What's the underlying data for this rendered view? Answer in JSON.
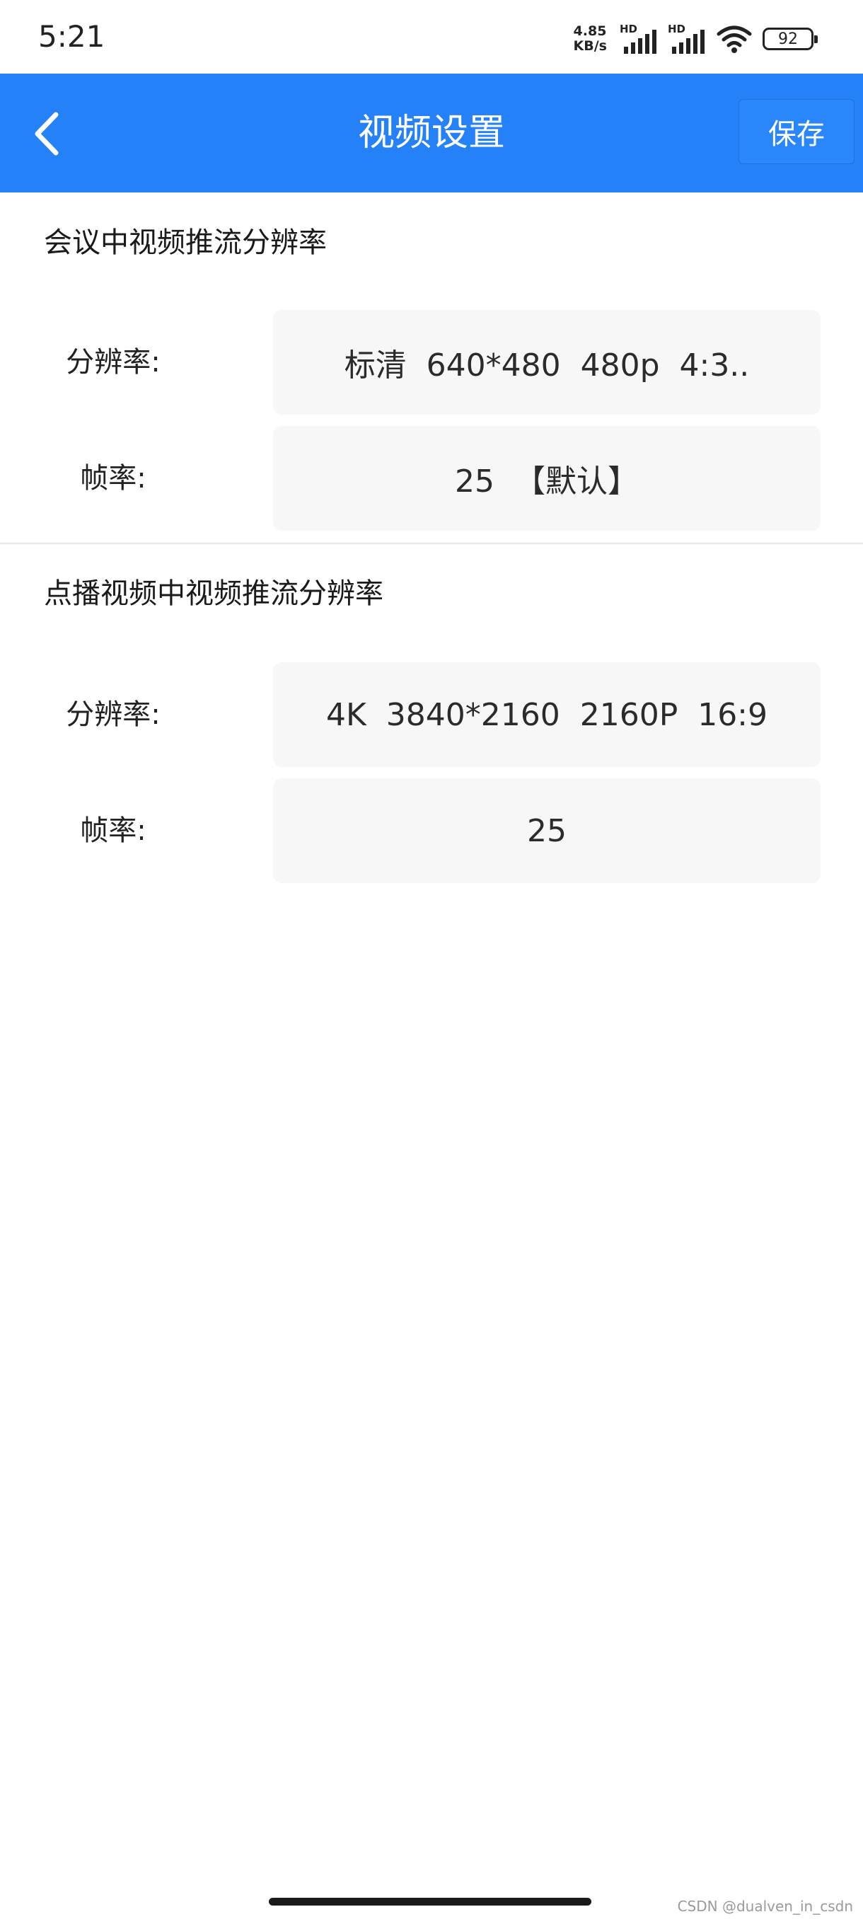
{
  "status_bar": {
    "time": "5:21",
    "net_speed_value": "4.85",
    "net_speed_unit": "KB/s",
    "signal_badge": "HD",
    "battery_level": "92",
    "icons": [
      "signal-icon",
      "signal-icon",
      "wifi-icon",
      "battery-icon"
    ]
  },
  "nav": {
    "title": "视频设置",
    "save_label": "保存",
    "back_icon": "chevron-left-icon"
  },
  "meeting_section": {
    "title": "会议中视频推流分辨率",
    "resolution_label": "分辨率:",
    "resolution_value": "标清  640*480  480p  4:3..",
    "framerate_label": "帧率:",
    "framerate_value": "25  【默认】"
  },
  "vod_section": {
    "title": "点播视频中视频推流分辨率",
    "resolution_label": "分辨率:",
    "resolution_value": "4K  3840*2160  2160P  16:9",
    "framerate_label": "帧率:",
    "framerate_value": "25"
  },
  "watermark": "CSDN @dualven_in_csdn",
  "colors": {
    "accent": "#2481f7",
    "value_box_bg": "#f7f7f7",
    "divider": "#e6e6e6"
  }
}
